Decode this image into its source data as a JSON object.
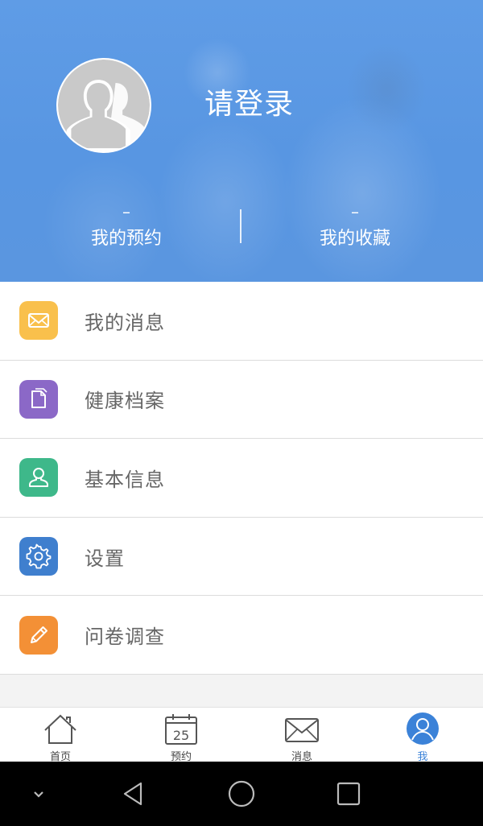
{
  "header": {
    "login_prompt": "请登录",
    "stats": [
      {
        "count": "–",
        "label": "我的预约"
      },
      {
        "count": "–",
        "label": "我的收藏"
      }
    ]
  },
  "menu": {
    "items": [
      {
        "label": "我的消息",
        "icon": "envelope-icon",
        "color": "#f9c04c"
      },
      {
        "label": "健康档案",
        "icon": "document-icon",
        "color": "#8b68c7"
      },
      {
        "label": "基本信息",
        "icon": "person-icon",
        "color": "#3eb88a"
      },
      {
        "label": "设置",
        "icon": "gear-icon",
        "color": "#3f7fce"
      },
      {
        "label": "问卷调查",
        "icon": "pencil-icon",
        "color": "#f39036"
      }
    ]
  },
  "tabbar": {
    "tabs": [
      {
        "label": "首页",
        "icon": "home-icon"
      },
      {
        "label": "预约",
        "icon": "calendar-icon",
        "calendar_day": "25"
      },
      {
        "label": "消息",
        "icon": "envelope-icon"
      },
      {
        "label": "我",
        "icon": "profile-icon",
        "active": true
      }
    ],
    "active_color": "#3b82d8"
  },
  "android_nav": {
    "buttons": [
      "chevron-down-icon",
      "back-triangle-icon",
      "home-circle-icon",
      "recents-square-icon"
    ]
  }
}
